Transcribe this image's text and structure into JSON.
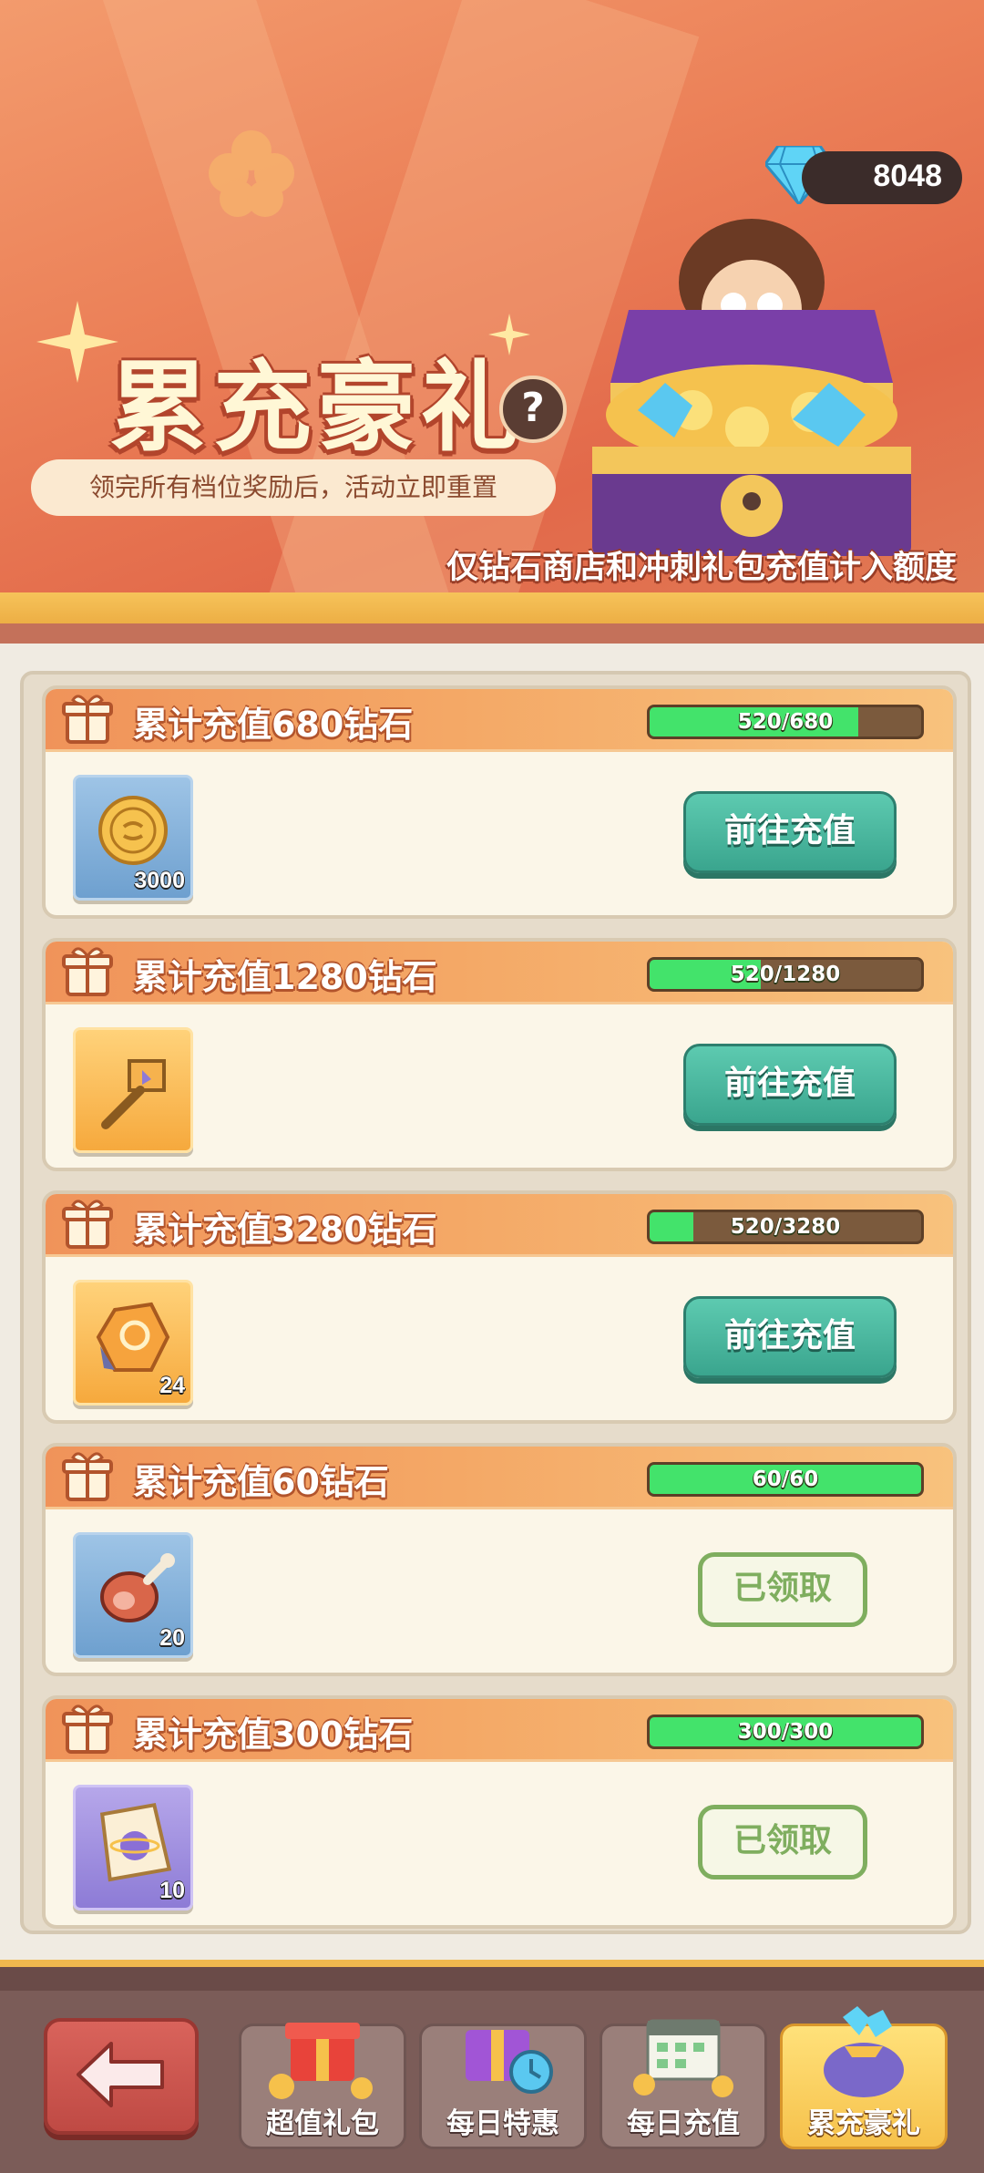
{
  "header": {
    "diamond_count": "8048",
    "title": "累充豪礼",
    "help_symbol": "?",
    "subtitle": "领完所有档位奖励后，活动立即重置",
    "notice": "仅钻石商店和冲刺礼包充值计入额度"
  },
  "tiers": [
    {
      "title": "累计充值680钻石",
      "progress_text": "520/680",
      "progress": 0.765,
      "reward_icon": "gold-coin-icon",
      "reward_count": "3000",
      "action": "前往充值",
      "state": "go"
    },
    {
      "title": "累计充值1280钻石",
      "progress_text": "520/1280",
      "progress": 0.406,
      "reward_icon": "hammer-icon",
      "reward_count": "",
      "action": "前往充值",
      "state": "go"
    },
    {
      "title": "累计充值3280钻石",
      "progress_text": "520/3280",
      "progress": 0.159,
      "reward_icon": "crystal-ore-icon",
      "reward_count": "24",
      "action": "前往充值",
      "state": "go"
    },
    {
      "title": "累计充值60钻石",
      "progress_text": "60/60",
      "progress": 1.0,
      "reward_icon": "meat-icon",
      "reward_count": "20",
      "action": "已领取",
      "state": "done"
    },
    {
      "title": "累计充值300钻石",
      "progress_text": "300/300",
      "progress": 1.0,
      "reward_icon": "integral-card-icon",
      "reward_count": "10",
      "action": "已领取",
      "state": "done"
    }
  ],
  "nav": {
    "back_icon": "arrow-left-icon",
    "tabs": [
      {
        "label": "超值礼包",
        "icon": "gift-coins-icon",
        "active": false
      },
      {
        "label": "每日特惠",
        "icon": "gift-clock-icon",
        "active": false
      },
      {
        "label": "每日充值",
        "icon": "calendar-coins-icon",
        "active": false
      },
      {
        "label": "累充豪礼",
        "icon": "diamond-bag-icon",
        "active": true
      }
    ]
  },
  "colors": {
    "banner": "#eb7f57",
    "go_button": "#3aa58e",
    "done_button": "#7fae5f",
    "progress_fill": "#43e36b",
    "active_tab": "#f6c14b"
  }
}
